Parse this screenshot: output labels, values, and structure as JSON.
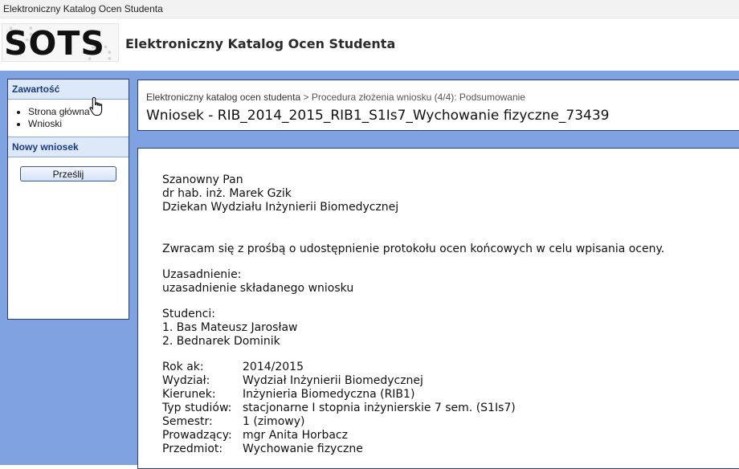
{
  "window": {
    "title": "Elektroniczny Katalog Ocen Studenta"
  },
  "header": {
    "logo": "SOTS",
    "title": "Elektroniczny Katalog Ocen Studenta"
  },
  "sidebar": {
    "contents_heading": "Zawartość",
    "items": [
      "Strona główna",
      "Wnioski"
    ],
    "new_request_heading": "Nowy wniosek",
    "send_button": "Prześlij"
  },
  "breadcrumb": {
    "root": "Elektroniczny katalog ocen studenta",
    "separator": ">",
    "current": "Procedura złożenia wniosku (4/4): Podsumowanie"
  },
  "page_title": "Wniosek - RIB_2014_2015_RIB1_S1Is7_Wychowanie fizyczne_73439",
  "letter": {
    "salutation": "Szanowny Pan",
    "recipient_name": "dr hab. inż. Marek Gzik",
    "recipient_role": "Dziekan Wydziału Inżynierii Biomedycznej",
    "request": "Zwracam się z prośbą o udostępnienie protokołu ocen końcowych w celu wpisania oceny.",
    "justification_label": "Uzasadnienie:",
    "justification": "uzasadnienie składanego wniosku",
    "students_label": "Studenci:",
    "students": [
      "1. Bas Mateusz Jarosław",
      "2. Bednarek Dominik"
    ],
    "meta": [
      {
        "key": "Rok ak:",
        "value": "2014/2015"
      },
      {
        "key": "Wydział:",
        "value": "Wydział Inżynierii Biomedycznej"
      },
      {
        "key": "Kierunek:",
        "value": "Inżynieria Biomedyczna (RIB1)"
      },
      {
        "key": "Typ studiów:",
        "value": "stacjonarne I stopnia inżynierskie 7 sem. (S1Is7)"
      },
      {
        "key": "Semestr:",
        "value": "1 (zimowy)"
      },
      {
        "key": "Prowadzący:",
        "value": "mgr Anita Horbacz"
      },
      {
        "key": "Przedmiot:",
        "value": "Wychowanie fizyczne"
      }
    ]
  },
  "colors": {
    "page_background": "#7fa3e0",
    "panel_border": "#2a3f7a",
    "heading_text": "#1b3a8a"
  }
}
